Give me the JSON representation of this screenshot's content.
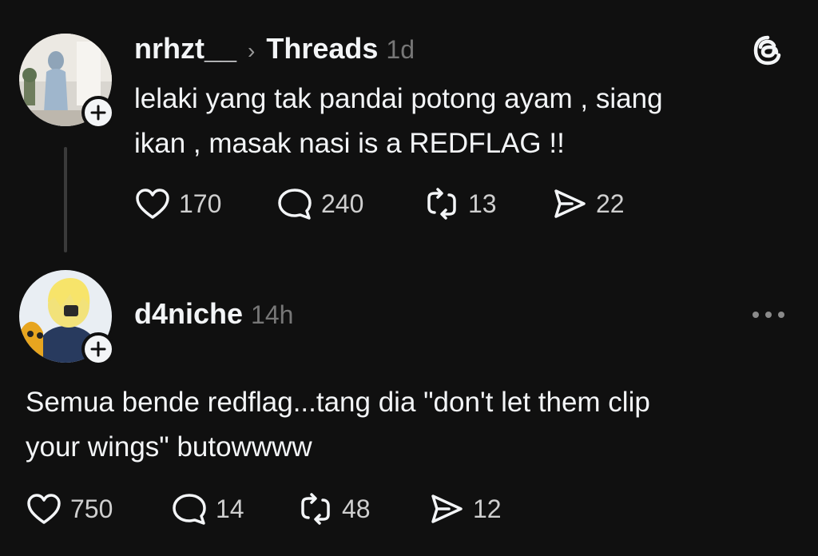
{
  "post": {
    "username": "nrhzt__",
    "separator": "›",
    "community": "Threads",
    "time": "1d",
    "text_line1": "lelaki yang tak pandai potong ayam , siang",
    "text_line2": "ikan , masak nasi is a REDFLAG !!",
    "stats": {
      "likes": "170",
      "replies": "240",
      "reposts": "13",
      "shares": "22"
    }
  },
  "reply": {
    "username": "d4niche",
    "time": "14h",
    "text_line1": "Semua bende redflag...tang dia \"don't let them clip",
    "text_line2": "your wings\" butowwww",
    "stats": {
      "likes": "750",
      "replies": "14",
      "reposts": "48",
      "shares": "12"
    }
  },
  "icons": {
    "app": "threads-logo-icon",
    "more": "more-options-icon",
    "like": "heart-icon",
    "reply": "comment-bubble-icon",
    "repost": "repost-icon",
    "share": "send-icon",
    "follow": "plus-icon"
  },
  "colors": {
    "background": "#101010",
    "text": "#f3f5f7",
    "muted": "#777777"
  }
}
